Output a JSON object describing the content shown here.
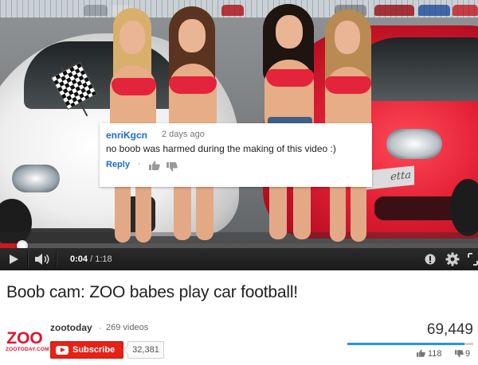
{
  "video": {
    "comment": {
      "author": "enriKgcn",
      "time": "2 days ago",
      "text": "no boob was harmed during the making of this video :)",
      "reply_label": "Reply",
      "separator": "·"
    },
    "car_plate_text": "etta"
  },
  "player": {
    "played_fraction": 0.04,
    "current_time": "0:04",
    "separator": "/",
    "duration": "1:18",
    "icons": {
      "play": "play-icon",
      "volume": "volume-icon",
      "captions": "captions-icon",
      "settings": "gear-icon",
      "size": "expand-icon"
    }
  },
  "title": "Boob cam: ZOO babes play car football!",
  "channel": {
    "logo": {
      "main": "ZOO",
      "sub": "ZOOTODAY.COM"
    },
    "name": "zootoday",
    "dot": "·",
    "video_count": "269 videos",
    "subscribe_label": "Subscribe",
    "subscriber_count": "32,381"
  },
  "stats": {
    "views": "69,449",
    "likes": "118",
    "dislikes": "9",
    "like_ratio": 0.929
  },
  "colors": {
    "accent_red": "#e62117",
    "link_blue": "#1b6bd1",
    "progress_red": "#cc181e",
    "like_blue": "#2793e6"
  }
}
